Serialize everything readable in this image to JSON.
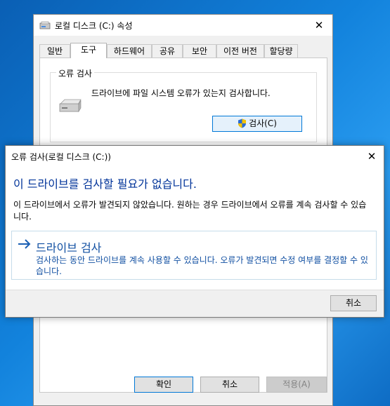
{
  "properties_window": {
    "title": "로컬 디스크 (C:) 속성",
    "tabs": [
      {
        "label": "일반"
      },
      {
        "label": "도구"
      },
      {
        "label": "하드웨어"
      },
      {
        "label": "공유"
      },
      {
        "label": "보안"
      },
      {
        "label": "이전 버전"
      },
      {
        "label": "할당량"
      }
    ],
    "error_check_group": {
      "title": "오류 검사",
      "description": "드라이브에 파일 시스템 오류가 있는지 검사합니다.",
      "check_button": "검사(C)"
    },
    "buttons": {
      "ok": "확인",
      "cancel": "취소",
      "apply": "적용(A)"
    }
  },
  "dialog": {
    "title": "오류 검사(로컬 디스크 (C:))",
    "heading": "이 드라이브를 검사할 필요가 없습니다.",
    "description": "이 드라이브에서 오류가 발견되지 않았습니다. 원하는 경우 드라이브에서 오류를 계속 검사할 수 있습니다.",
    "command_link": {
      "title": "드라이브 검사",
      "description": "검사하는 동안 드라이브를 계속 사용할 수 있습니다. 오류가 발견되면 수정 여부를 결정할 수 있습니다."
    },
    "cancel": "취소"
  },
  "colors": {
    "accent_blue": "#0078d7",
    "heading_blue": "#003399",
    "link_blue": "#0f4ea1"
  }
}
